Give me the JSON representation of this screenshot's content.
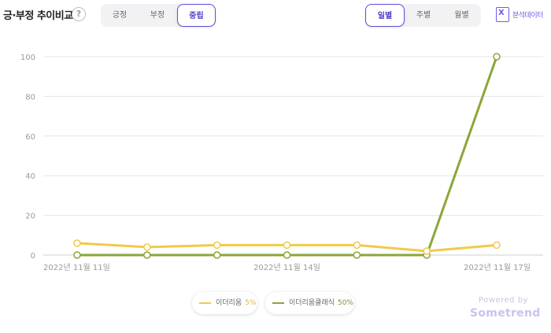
{
  "header": {
    "title": "긍·부정 추이비교",
    "help_icon": "?",
    "sentiment_tabs": [
      "긍정",
      "부정",
      "중립"
    ],
    "sentiment_active": 2,
    "period_tabs": [
      "일별",
      "주별",
      "월별"
    ],
    "period_active": 0,
    "export_label": "분석데이터"
  },
  "chart_data": {
    "type": "line",
    "x": [
      "2022-11-11",
      "2022-11-12",
      "2022-11-13",
      "2022-11-14",
      "2022-11-15",
      "2022-11-16",
      "2022-11-17"
    ],
    "tick_labels": [
      "2022년 11월 11일",
      "",
      "",
      "2022년 11월 14일",
      "",
      "",
      "2022년 11월 17일"
    ],
    "ylim": [
      0,
      100
    ],
    "yticks": [
      0,
      20,
      40,
      60,
      80,
      100
    ],
    "grid": true,
    "series": [
      {
        "name": "이더리움",
        "share": "5%",
        "color": "#f2c94c",
        "values": [
          6,
          4,
          5,
          5,
          5,
          2,
          5
        ]
      },
      {
        "name": "이더리움클래식",
        "share": "50%",
        "color": "#8aa63a",
        "values": [
          0,
          0,
          0,
          0,
          0,
          0,
          100
        ]
      }
    ],
    "legend_position": "bottom-center"
  },
  "footer": {
    "powered_by": "Powered by",
    "brand": "Sometrend"
  }
}
